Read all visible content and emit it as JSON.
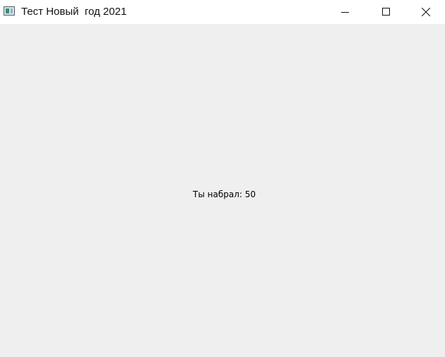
{
  "window": {
    "title": "Тест Новый  год 2021",
    "icon": "app-window-icon",
    "controls": {
      "minimize_icon": "minimize-icon",
      "maximize_icon": "maximize-icon",
      "close_icon": "close-icon"
    }
  },
  "content": {
    "result_text": "Ты набрал: 50"
  },
  "colors": {
    "titlebar_bg": "#ffffff",
    "content_bg": "#efefef"
  }
}
